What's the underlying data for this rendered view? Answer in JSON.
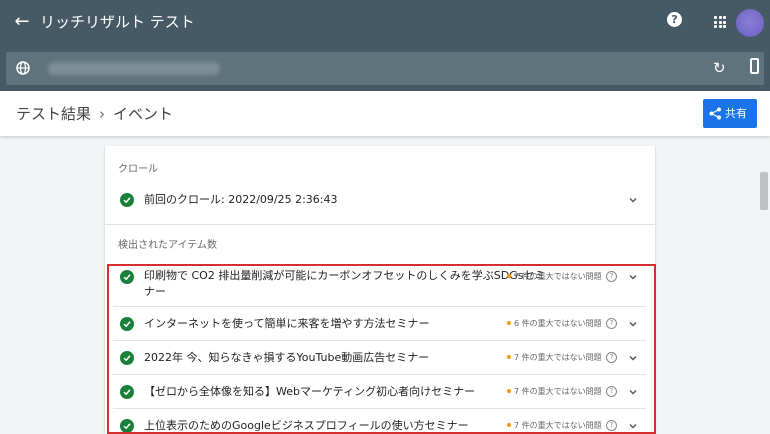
{
  "header": {
    "title": "リッチリザルト テスト",
    "back_icon": "arrow-left-icon",
    "help_icon": "help-icon",
    "apps_icon": "apps-icon"
  },
  "urlbar": {
    "globe_icon": "globe-icon",
    "reload_icon": "reload-icon",
    "device_icon": "mobile-icon"
  },
  "breadcrumb": {
    "root": "テスト結果",
    "separator": "›",
    "current": "イベント"
  },
  "share_button": {
    "label": "共有"
  },
  "crawl": {
    "section_label": "クロール",
    "row": "前回のクロール: 2022/09/25 2:36:43"
  },
  "items": {
    "section_label": "検出されたアイテム数",
    "list": [
      {
        "line1": "印刷物で CO2 排出量削減が可能にカーボンオフセットのしくみを学ぶSDGsセミ",
        "line2": "ナー",
        "issue": "7 件の重大ではない問題"
      },
      {
        "line1": "インターネットを使って簡単に来客を増やす方法セミナー",
        "line2": "",
        "issue": "6 件の重大ではない問題"
      },
      {
        "line1": "2022年 今、知らなきゃ損するYouTube動画広告セミナー",
        "line2": "",
        "issue": "7 件の重大ではない問題"
      },
      {
        "line1": "【ゼロから全体像を知る】Webマーケティング初心者向けセミナー",
        "line2": "",
        "issue": "7 件の重大ではない問題"
      },
      {
        "line1": "上位表示のためのGoogleビジネスプロフィールの使い方セミナー",
        "line2": "",
        "issue": "7 件の重大ではない問題"
      }
    ]
  },
  "colors": {
    "appbar": "#455a64",
    "accent": "#1a73e8",
    "ok": "#188038",
    "warning": "#f29900",
    "highlight": "#d32f2f"
  }
}
